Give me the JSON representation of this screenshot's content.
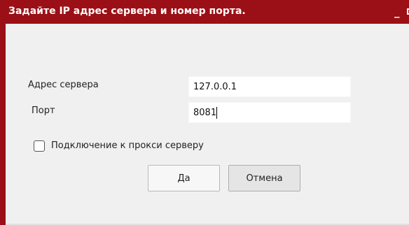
{
  "window": {
    "title": "Задайте IP адрес сервера и номер порта.",
    "minimize_label": "_",
    "maximize_label": ""
  },
  "form": {
    "server_label": "Адрес сервера",
    "server_value": "127.0.0.1",
    "port_label": "Порт",
    "port_value": "8081",
    "proxy_label": "Подключение к прокси серверу",
    "proxy_checked": false
  },
  "buttons": {
    "ok_label": "Да",
    "cancel_label": "Отмена"
  },
  "colors": {
    "titlebar": "#9b1016",
    "background": "#f0f0f0",
    "input_background": "#ffffff"
  },
  "icons": {
    "minimize": "minimize-icon",
    "maximize": "maximize-icon",
    "checkbox": "checkbox-icon"
  }
}
